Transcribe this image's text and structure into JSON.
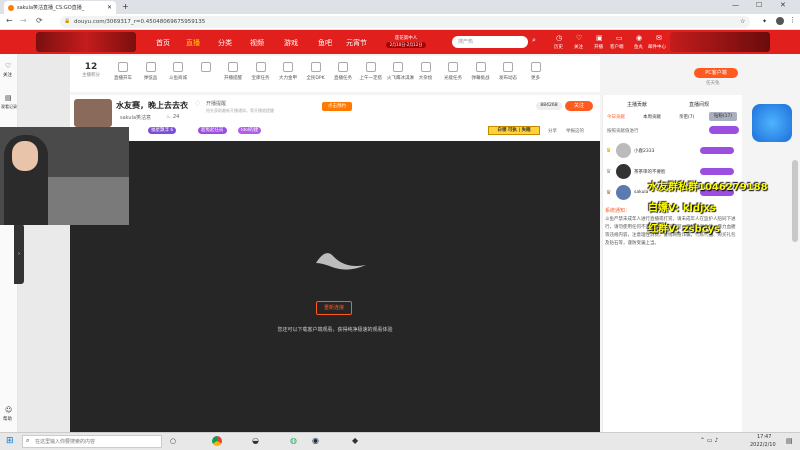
{
  "browser": {
    "tab_title": "sakula笑沽直播_CS:GO直播_",
    "url": "douyu.com/3069317_r=0.45048069675959135"
  },
  "header": {
    "nav": [
      "首页",
      "直播",
      "分类",
      "视频",
      "游戏",
      "鱼吧",
      "元宵节"
    ],
    "promo_top": "莲花第中人",
    "promo_bottom": "2月10日-2月12日",
    "search_placeholder": "搜产热",
    "icons": [
      "历史",
      "关注",
      "开播",
      "客户端",
      "鱼丸",
      "邮件中心"
    ]
  },
  "rail": {
    "follow": "关注",
    "record": "观看记录",
    "bottom": "帮助"
  },
  "toolbar": {
    "level": "12",
    "level_label": "主播积分",
    "items": [
      "直播开车",
      "弹弦品",
      "斗鱼商城",
      "",
      "开播提醒",
      "宝库任务",
      "大力金甲",
      "全民DPK",
      "直播任务",
      "上午一定搭",
      "火飞鹰冰淇淋",
      "大杂烩",
      "光能任务",
      "弹幕挑战",
      "发布动态",
      "更多"
    ],
    "pc_button": "PC客户端",
    "pc_sub": "任天兔"
  },
  "room": {
    "title": "水友赛，晚上去去衣",
    "streamer": "sakula笑沽意",
    "hot": "24",
    "reminder_title": "开播提醒",
    "reminder_sub": "抢先获取最新开播通知，等开播就提醒",
    "reminder_btn": "点击预约",
    "count": "884268",
    "follow_btn": "关注",
    "tags": [
      "福星飘浮 6",
      "超冤起任前",
      "Idol的建"
    ],
    "badge": "白领 可执 | 失眠",
    "share": "分享",
    "report": "举报这的"
  },
  "video": {
    "retry_button": "重新连接",
    "message": "您还可以下载客户端观看，获得纯净极速的观看体验",
    "message_link": "下载客户端"
  },
  "right": {
    "tab_rank": "主播贡献",
    "tab_fans": "直播间规",
    "sub_tabs": [
      "今日贡献",
      "本周贡献",
      "亲密(7)",
      "钻粉(17)"
    ],
    "pass_label": "按照贡献值进行",
    "rank_users": [
      "小鹿2333",
      "茶茶审的不要脸",
      "sakula"
    ],
    "sys_title": "系统通知：",
    "sys_text": "斗鱼严禁未成年人进行直播或打赏，请未成年人在监护人陪同下进行，请勿使用任何不正当方式进行打赏，严禁低俗色情、暴力血腥等违规内容，注意理性消费。警惕网络诈骗，代练代抽、购买礼包及钻石等，谨防受骗上当。"
  },
  "danmaku": [
    {
      "text": "水友群私群1046279188"
    },
    {
      "text": "白嫖V: kldjxs"
    },
    {
      "text": "红群V: zsbcys"
    }
  ],
  "taskbar": {
    "search_placeholder": "在这里输入你要搜索的内容",
    "time": "17:47",
    "date": "2022/2/10"
  },
  "colors": {
    "brand": "#e1201e",
    "accent": "#ff7a00"
  }
}
